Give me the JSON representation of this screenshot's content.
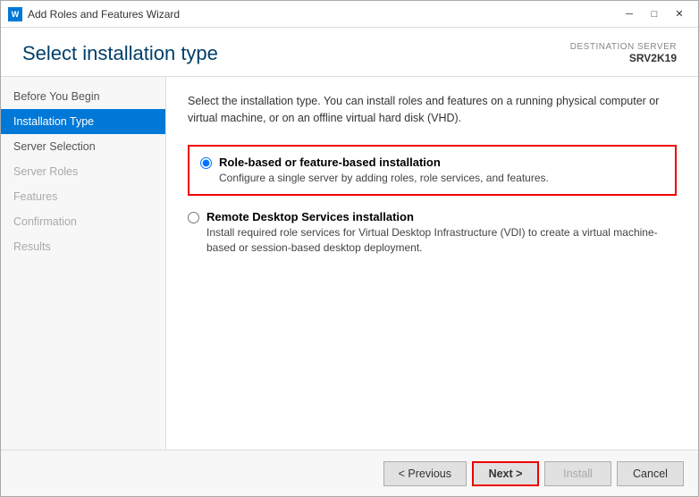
{
  "window": {
    "title": "Add Roles and Features Wizard",
    "icon": "W",
    "controls": {
      "minimize": "─",
      "maximize": "□",
      "close": "✕"
    }
  },
  "header": {
    "title": "Select installation type",
    "destination_label": "DESTINATION SERVER",
    "destination_server": "SRV2K19"
  },
  "sidebar": {
    "items": [
      {
        "label": "Before You Begin",
        "state": "normal"
      },
      {
        "label": "Installation Type",
        "state": "active"
      },
      {
        "label": "Server Selection",
        "state": "normal"
      },
      {
        "label": "Server Roles",
        "state": "disabled"
      },
      {
        "label": "Features",
        "state": "disabled"
      },
      {
        "label": "Confirmation",
        "state": "disabled"
      },
      {
        "label": "Results",
        "state": "disabled"
      }
    ]
  },
  "content": {
    "description": "Select the installation type. You can install roles and features on a running physical computer or virtual machine, or on an offline virtual hard disk (VHD).",
    "options": [
      {
        "id": "role-based",
        "title": "Role-based or feature-based installation",
        "description": "Configure a single server by adding roles, role services, and features.",
        "selected": true
      },
      {
        "id": "remote-desktop",
        "title": "Remote Desktop Services installation",
        "description": "Install required role services for Virtual Desktop Infrastructure (VDI) to create a virtual machine-based or session-based desktop deployment.",
        "selected": false
      }
    ]
  },
  "footer": {
    "previous_label": "< Previous",
    "next_label": "Next >",
    "install_label": "Install",
    "cancel_label": "Cancel"
  }
}
